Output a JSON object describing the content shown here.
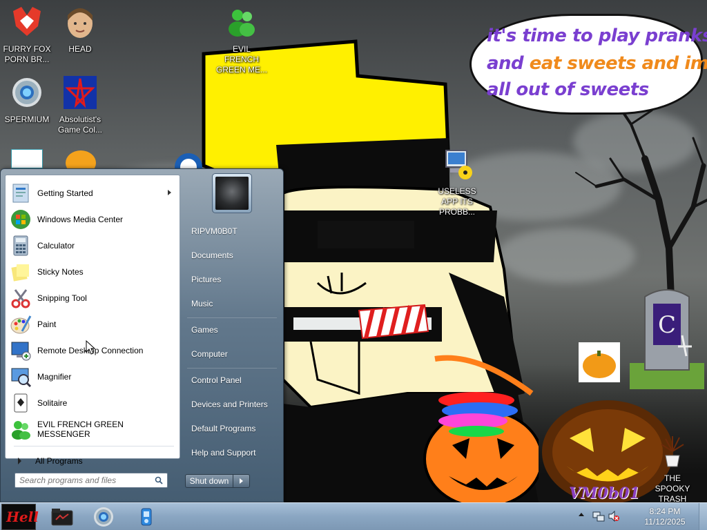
{
  "desktop": {
    "speech_bubble": {
      "line1": "it's time to play pranks",
      "line2_a": "and ",
      "line2_b": "eat sweets and im",
      "line3": "all out of sweets"
    },
    "watermark": "VM0b01",
    "icons": [
      {
        "name": "furry-fox-icon",
        "label": "FURRY FOX PORN BR..."
      },
      {
        "name": "head-icon",
        "label": "HEAD"
      },
      {
        "name": "evil-french-green-messenger-desktop-icon",
        "label": "EVIL FRENCH GREEN ME..."
      },
      {
        "name": "spermium-icon",
        "label": "SPERMIUM"
      },
      {
        "name": "absolutist-game-icon",
        "label": "Absolutist's Game Col..."
      },
      {
        "name": "useless-app-icon",
        "label": "USELESS APP ITS PROBB..."
      },
      {
        "name": "spooky-trash-icon",
        "label": "THE SPOOKY TRASH"
      }
    ]
  },
  "start_menu": {
    "programs": [
      {
        "label": "Getting Started",
        "icon": "getting-started-icon",
        "submenu": true
      },
      {
        "label": "Windows Media Center",
        "icon": "media-center-icon"
      },
      {
        "label": "Calculator",
        "icon": "calculator-icon"
      },
      {
        "label": "Sticky Notes",
        "icon": "sticky-notes-icon"
      },
      {
        "label": "Snipping Tool",
        "icon": "snipping-tool-icon"
      },
      {
        "label": "Paint",
        "icon": "paint-icon"
      },
      {
        "label": "Remote Desktop Connection",
        "icon": "remote-desktop-icon"
      },
      {
        "label": "Magnifier",
        "icon": "magnifier-icon"
      },
      {
        "label": "Solitaire",
        "icon": "solitaire-icon"
      },
      {
        "label": "EVIL FRENCH GREEN MESSENGER",
        "icon": "messenger-icon"
      }
    ],
    "all_programs": "All Programs",
    "search_placeholder": "Search programs and files",
    "places": {
      "user": "RIPVM0B0T",
      "documents": "Documents",
      "pictures": "Pictures",
      "music": "Music",
      "games": "Games",
      "computer": "Computer",
      "control_panel": "Control Panel",
      "devices": "Devices and Printers",
      "default_programs": "Default Programs",
      "help": "Help and Support"
    },
    "shutdown_label": "Shut down"
  },
  "taskbar": {
    "start_label": "Hell",
    "clock": {
      "time": "8:24 PM",
      "date": "11/12/2025"
    }
  },
  "colors": {
    "speech_purple": "#7a3fd0",
    "speech_orange": "#f08a1c",
    "character_yellow": "#fff000",
    "skin": "#fbf3c5",
    "pumpkin_orange": "#ff7f1a"
  }
}
